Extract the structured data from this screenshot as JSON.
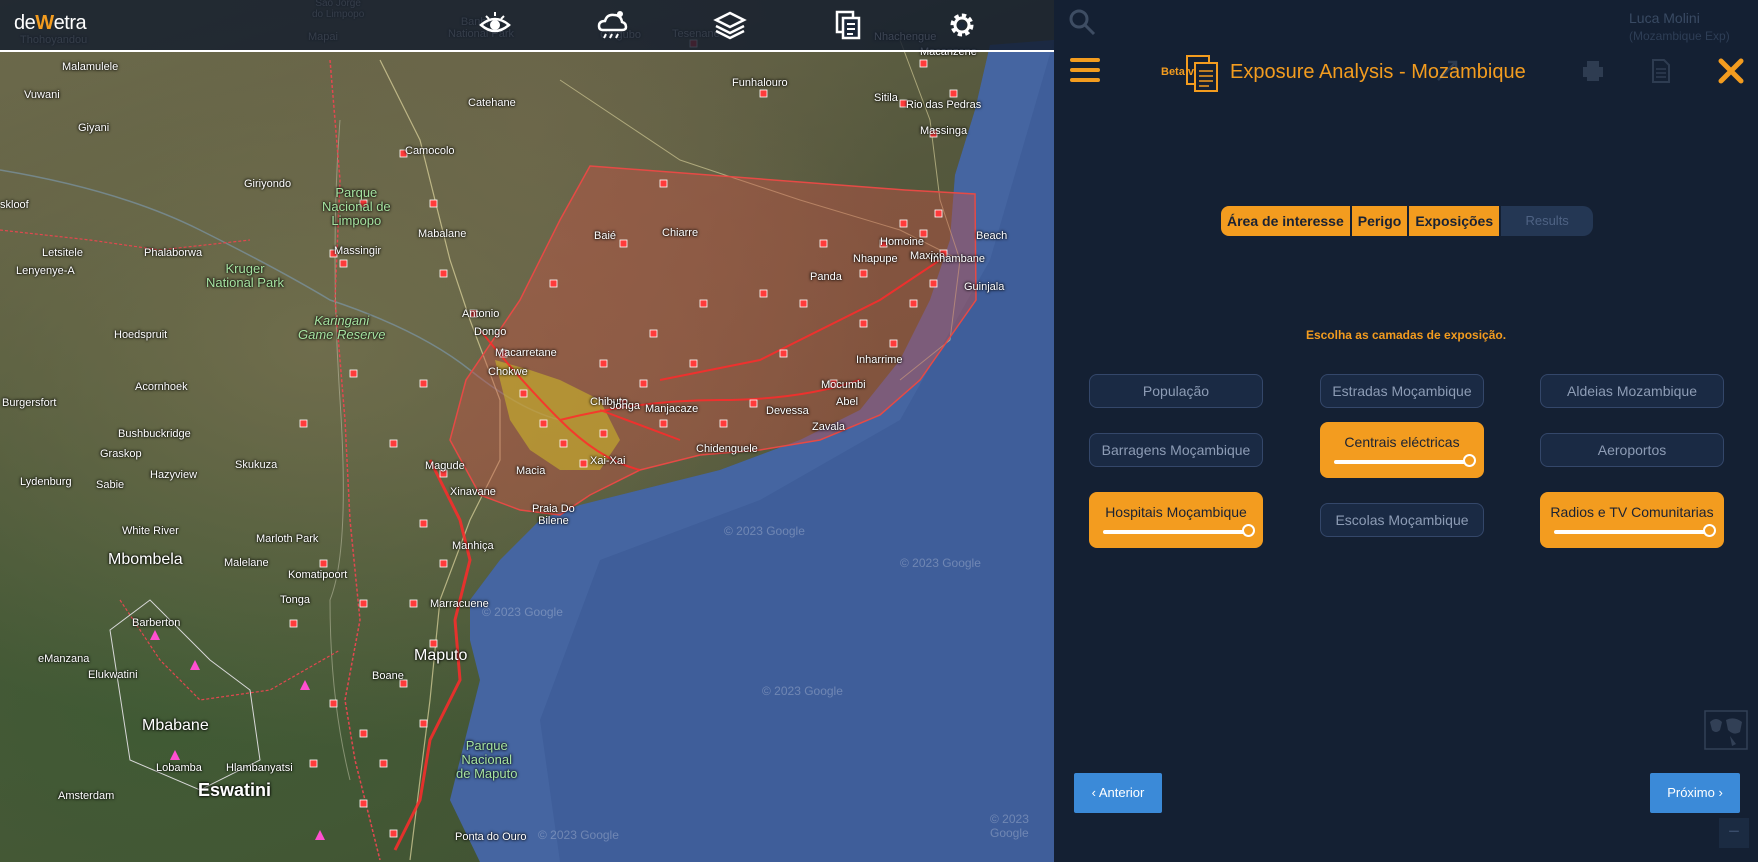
{
  "app": {
    "logo_prefix": "de",
    "logo_accent": "W",
    "logo_suffix": "etra"
  },
  "toolbar": {
    "icons": [
      "eye-icon",
      "weather-icon",
      "layers-icon",
      "documents-icon",
      "gear-icon"
    ]
  },
  "map": {
    "labels": [
      {
        "text": "Malamulele",
        "cls": ""
      },
      {
        "text": "Vuwani",
        "cls": ""
      },
      {
        "text": "Giyani",
        "cls": ""
      },
      {
        "text": "Giriyondo",
        "cls": ""
      },
      {
        "text": "Parque\nNacional de\nLimpopo",
        "cls": "park"
      },
      {
        "text": "Kruger\nNational Park",
        "cls": "park"
      },
      {
        "text": "Karingani\nGame Reserve",
        "cls": "park"
      },
      {
        "text": "Phalaborwa",
        "cls": ""
      },
      {
        "text": "Letsitele",
        "cls": ""
      },
      {
        "text": "Lenyenye-A",
        "cls": ""
      },
      {
        "text": "Hoedspruit",
        "cls": ""
      },
      {
        "text": "Acornhoek",
        "cls": ""
      },
      {
        "text": "Burgersfort",
        "cls": ""
      },
      {
        "text": "Bushbuckridge",
        "cls": ""
      },
      {
        "text": "Graskop",
        "cls": ""
      },
      {
        "text": "Sabie",
        "cls": ""
      },
      {
        "text": "Lydenburg",
        "cls": ""
      },
      {
        "text": "Hazyview",
        "cls": ""
      },
      {
        "text": "Skukuza",
        "cls": ""
      },
      {
        "text": "White River",
        "cls": ""
      },
      {
        "text": "Mbombela",
        "cls": "big"
      },
      {
        "text": "Marloth Park",
        "cls": ""
      },
      {
        "text": "Malelane",
        "cls": ""
      },
      {
        "text": "Komatipoort",
        "cls": ""
      },
      {
        "text": "Barberton",
        "cls": ""
      },
      {
        "text": "eManzana",
        "cls": ""
      },
      {
        "text": "Elukwatini",
        "cls": ""
      },
      {
        "text": "Mbabane",
        "cls": "big"
      },
      {
        "text": "Lobamba",
        "cls": ""
      },
      {
        "text": "Hlambanyatsi",
        "cls": ""
      },
      {
        "text": "Eswatini",
        "cls": "bigger"
      },
      {
        "text": "Amsterdam",
        "cls": ""
      },
      {
        "text": "Tonga",
        "cls": ""
      },
      {
        "text": "Catehane",
        "cls": ""
      },
      {
        "text": "Camocolo",
        "cls": ""
      },
      {
        "text": "Mabalane",
        "cls": ""
      },
      {
        "text": "Massingir",
        "cls": ""
      },
      {
        "text": "Antonio",
        "cls": ""
      },
      {
        "text": "Magude",
        "cls": ""
      },
      {
        "text": "Funhalouro",
        "cls": ""
      },
      {
        "text": "Sitila",
        "cls": ""
      },
      {
        "text": "Rio das Pedras",
        "cls": ""
      },
      {
        "text": "Massinga",
        "cls": ""
      },
      {
        "text": "Baié",
        "cls": ""
      },
      {
        "text": "Chiarre",
        "cls": ""
      },
      {
        "text": "Panda",
        "cls": ""
      },
      {
        "text": "Homoine",
        "cls": ""
      },
      {
        "text": "Nhapupe",
        "cls": ""
      },
      {
        "text": "Beach",
        "cls": ""
      },
      {
        "text": "Guinjala",
        "cls": ""
      },
      {
        "text": "Inharrime",
        "cls": ""
      },
      {
        "text": "Mocumbi",
        "cls": ""
      },
      {
        "text": "Abel",
        "cls": ""
      },
      {
        "text": "Devessa",
        "cls": ""
      },
      {
        "text": "Zavala",
        "cls": ""
      },
      {
        "text": "Chidenguele",
        "cls": ""
      },
      {
        "text": "Macarretane",
        "cls": ""
      },
      {
        "text": "Chokwe",
        "cls": ""
      },
      {
        "text": "Manjacaze",
        "cls": ""
      },
      {
        "text": "Macia",
        "cls": ""
      },
      {
        "text": "Praia Do\nBilene",
        "cls": ""
      },
      {
        "text": "Xinavane",
        "cls": ""
      },
      {
        "text": "Manhiça",
        "cls": ""
      },
      {
        "text": "Marracuene",
        "cls": ""
      },
      {
        "text": "Maputo",
        "cls": "big"
      },
      {
        "text": "Boane",
        "cls": ""
      },
      {
        "text": "Parque\nNacional\nde Maputo",
        "cls": "park"
      },
      {
        "text": "Ponta do Ouro",
        "cls": ""
      },
      {
        "text": "Macanzene",
        "cls": ""
      },
      {
        "text": "Nhachengue",
        "cls": ""
      },
      {
        "text": "Banhine\nNational Park",
        "cls": ""
      },
      {
        "text": "Chigubo",
        "cls": ""
      },
      {
        "text": "Tesenane",
        "cls": ""
      },
      {
        "text": "Thohoyandou",
        "cls": ""
      },
      {
        "text": "Mapai",
        "cls": ""
      },
      {
        "text": "Sao Jorge\ndo Limpopo",
        "cls": ""
      },
      {
        "text": "skloof",
        "cls": ""
      },
      {
        "text": "Dongo",
        "cls": ""
      },
      {
        "text": "Chibuto",
        "cls": ""
      },
      {
        "text": "Jonga",
        "cls": ""
      },
      {
        "text": "Xai-Xai",
        "cls": ""
      },
      {
        "text": "Maxixe",
        "cls": ""
      },
      {
        "text": "Inhambane",
        "cls": ""
      }
    ],
    "watermarks": [
      "© 2023 Google",
      "© 2023 Google",
      "© 2023 Google",
      "© 2023 Google",
      "© 2023 Google",
      "© 2023 Google"
    ]
  },
  "panel": {
    "user_name": "Luca Molini",
    "user_org": "(Mozambique Exp)",
    "beta_label": "Beta v.",
    "title": "Exposure Analysis - Mozambique",
    "tabs": [
      "Área de interesse",
      "Perigo",
      "Exposições",
      "Results"
    ],
    "prompt": "Escolha as camadas de exposição.",
    "layers": [
      {
        "label": "População",
        "active": false
      },
      {
        "label": "Estradas Moçambique",
        "active": false
      },
      {
        "label": "Aldeias Mozambique",
        "active": false
      },
      {
        "label": "Barragens Moçambique",
        "active": false
      },
      {
        "label": "Centrais eléctricas",
        "active": true
      },
      {
        "label": "Aeroportos",
        "active": false
      },
      {
        "label": "Hospitais Moçambique",
        "active": true
      },
      {
        "label": "Escolas Moçambique",
        "active": false
      },
      {
        "label": "Radios e TV Comunitarias",
        "active": true
      }
    ],
    "prev_label": "‹ Anterior",
    "next_label": "Próximo ›",
    "zoom_minus": "−"
  },
  "colors": {
    "accent": "#f39c1f",
    "panel_bg": "#142033",
    "button_blue": "#3b8ad8",
    "aoi_red": "#d9363e"
  }
}
